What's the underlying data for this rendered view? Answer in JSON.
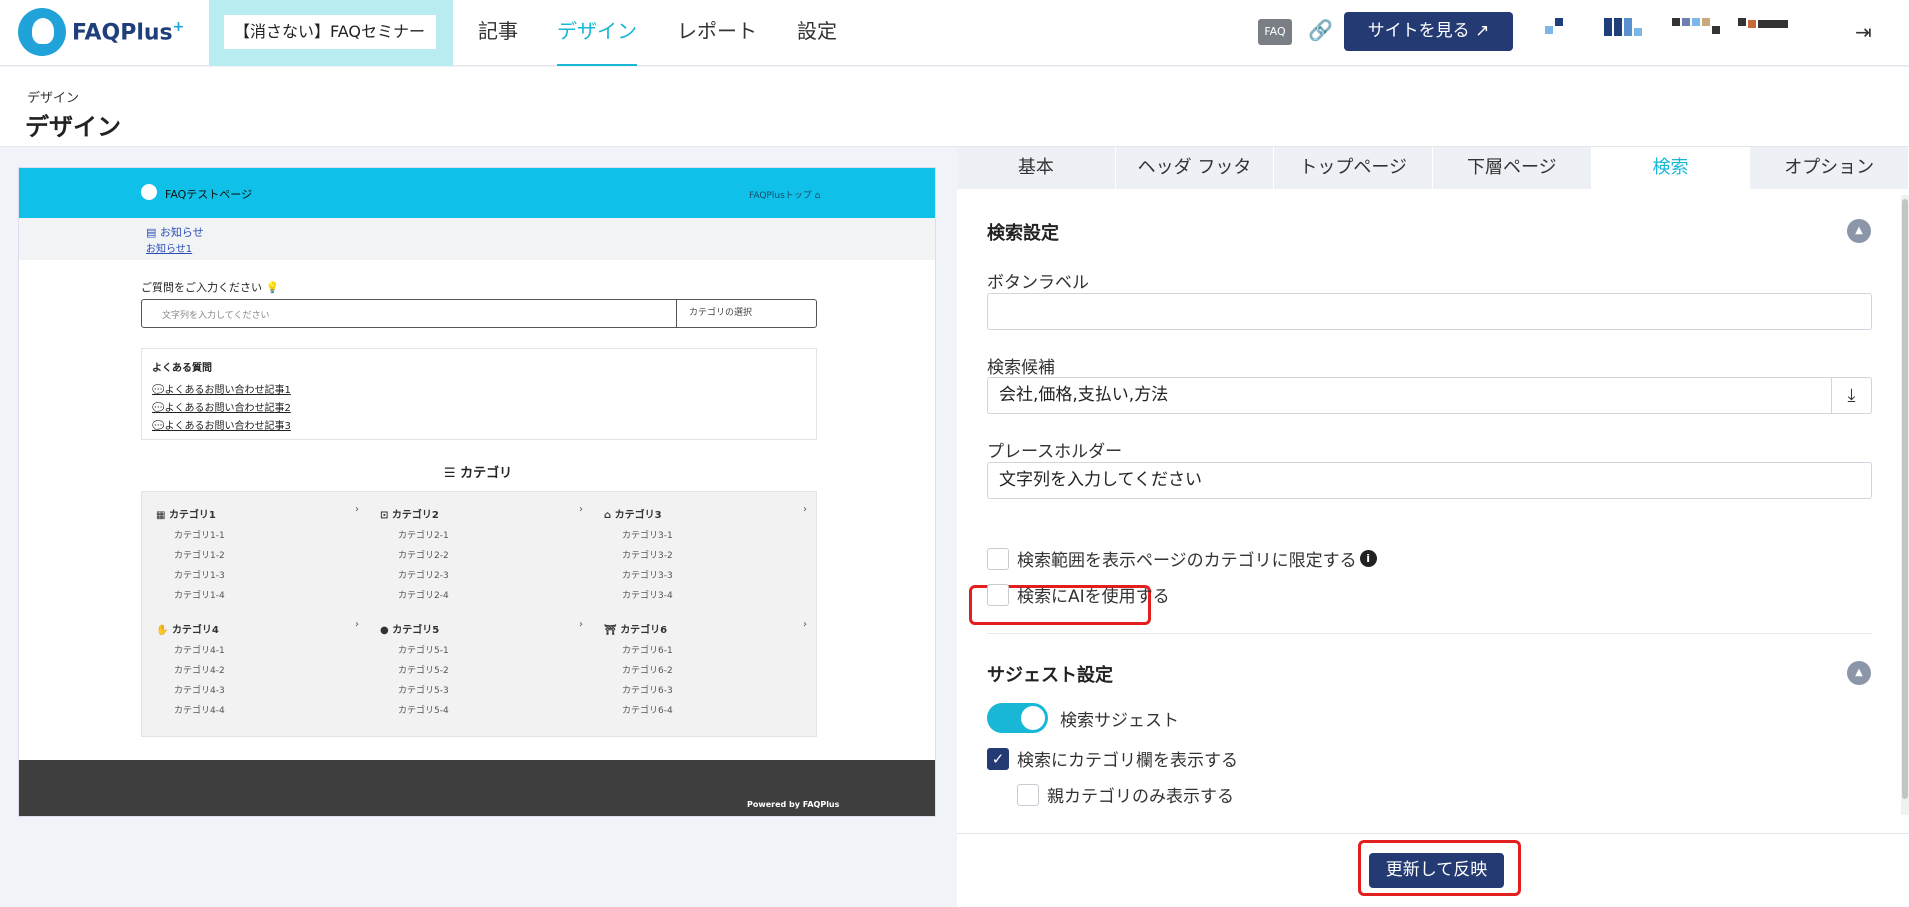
{
  "app": {
    "logo_text": "FAQPlus",
    "logo_plus": "+"
  },
  "header": {
    "site_selector": "【消さない】FAQセミナー",
    "nav": [
      "記事",
      "デザイン",
      "レポート",
      "設定"
    ],
    "faq_badge": "FAQ",
    "view_site_label": "サイトを見る"
  },
  "page": {
    "breadcrumb": "デザイン",
    "title": "デザイン"
  },
  "preview": {
    "site_name": "FAQテストページ",
    "top_link": "FAQPlusトップ",
    "news_title": "お知らせ",
    "news_link": "お知らせ1",
    "question_label": "ご質問をご入力ください",
    "search_placeholder": "文字列を入力してください",
    "category_select": "カテゴリの選択",
    "faq_title": "よくある質問",
    "faq_items": [
      "よくあるお問い合わせ記事1",
      "よくあるお問い合わせ記事2",
      "よくあるお問い合わせ記事3"
    ],
    "category_heading": "カテゴリ",
    "categories": [
      {
        "name": "カテゴリ1",
        "subs": [
          "カテゴリ1-1",
          "カテゴリ1-2",
          "カテゴリ1-3",
          "カテゴリ1-4"
        ]
      },
      {
        "name": "カテゴリ2",
        "subs": [
          "カテゴリ2-1",
          "カテゴリ2-2",
          "カテゴリ2-3",
          "カテゴリ2-4"
        ]
      },
      {
        "name": "カテゴリ3",
        "subs": [
          "カテゴリ3-1",
          "カテゴリ3-2",
          "カテゴリ3-3",
          "カテゴリ3-4"
        ]
      },
      {
        "name": "カテゴリ4",
        "subs": [
          "カテゴリ4-1",
          "カテゴリ4-2",
          "カテゴリ4-3",
          "カテゴリ4-4"
        ]
      },
      {
        "name": "カテゴリ5",
        "subs": [
          "カテゴリ5-1",
          "カテゴリ5-2",
          "カテゴリ5-3",
          "カテゴリ5-4"
        ]
      },
      {
        "name": "カテゴリ6",
        "subs": [
          "カテゴリ6-1",
          "カテゴリ6-2",
          "カテゴリ6-3",
          "カテゴリ6-4"
        ]
      }
    ],
    "powered_by": "Powered by FAQPlus"
  },
  "settings": {
    "tabs": [
      "基本",
      "ヘッダ フッタ",
      "トップページ",
      "下層ページ",
      "検索",
      "オプション"
    ],
    "active_tab": "検索",
    "search_section": "検索設定",
    "button_label_label": "ボタンラベル",
    "button_label_value": "",
    "suggest_words_label": "検索候補",
    "suggest_words_value": "会社,価格,支払い,方法",
    "placeholder_label": "プレースホルダー",
    "placeholder_value": "文字列を入力してください",
    "limit_scope_label": "検索範囲を表示ページのカテゴリに限定する",
    "use_ai_label": "検索にAIを使用する",
    "suggest_section": "サジェスト設定",
    "search_suggest_label": "検索サジェスト",
    "show_category_label": "検索にカテゴリ欄を表示する",
    "parent_only_label": "親カテゴリのみ表示する",
    "update_button": "更新して反映"
  },
  "colors": {
    "accent": "#19b7d6",
    "primary": "#243a73",
    "highlight": "#e31e1e"
  }
}
